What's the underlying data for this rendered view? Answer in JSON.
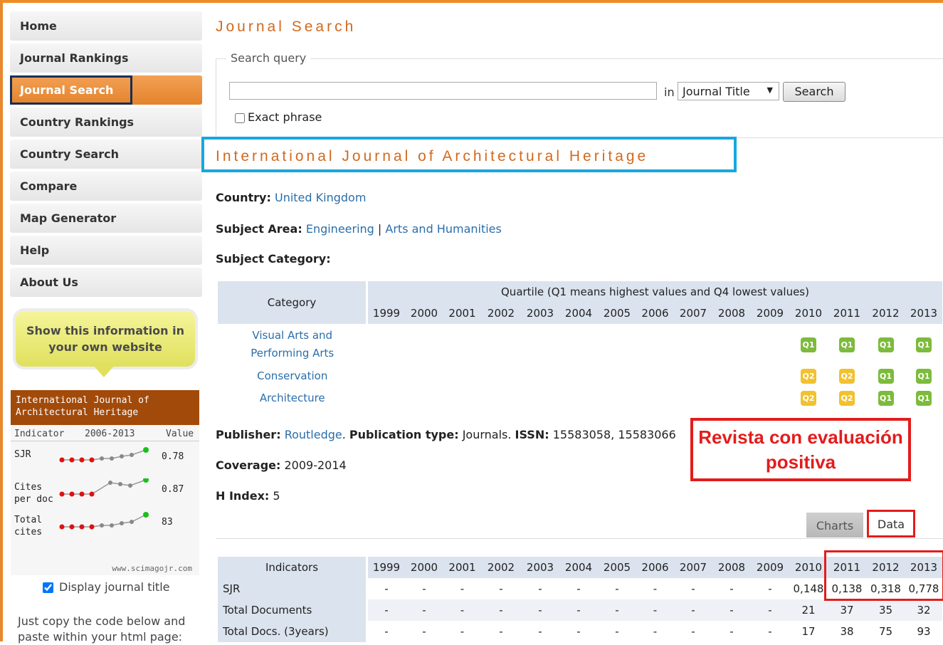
{
  "sidebar": {
    "items": [
      {
        "label": "Home"
      },
      {
        "label": "Journal Rankings"
      },
      {
        "label": "Journal Search"
      },
      {
        "label": "Country Rankings"
      },
      {
        "label": "Country Search"
      },
      {
        "label": "Compare"
      },
      {
        "label": "Map Generator"
      },
      {
        "label": "Help"
      },
      {
        "label": "About Us"
      }
    ],
    "bubble_text": "Show this information in your own website",
    "widget": {
      "title": "International Journal of Architectural Heritage",
      "col_indicator": "Indicator",
      "col_range": "2006-2013",
      "col_value": "Value",
      "rows": [
        {
          "label": "SJR",
          "value": "0.78"
        },
        {
          "label": "Cites per doc",
          "value": "0.87"
        },
        {
          "label": "Total cites",
          "value": "83"
        }
      ],
      "footer": "www.scimagojr.com"
    },
    "display_title_label": "Display journal title",
    "copy_text": "Just copy the code below and paste within your html page:"
  },
  "main": {
    "page_title": "Journal Search",
    "search": {
      "legend": "Search query",
      "value": "",
      "in_label": "in",
      "scope": "Journal Title",
      "button": "Search",
      "exact_label": "Exact phrase"
    },
    "journal_title": "International Journal of Architectural Heritage",
    "country_label": "Country:",
    "country": "United Kingdom",
    "subject_area_label": "Subject Area:",
    "subject_areas": [
      "Engineering",
      "Arts and Humanities"
    ],
    "subject_sep": "|",
    "subject_category_label": "Subject Category:",
    "quartile_table": {
      "category_header": "Category",
      "quartile_header": "Quartile (Q1 means highest values and Q4 lowest values)",
      "years": [
        "1999",
        "2000",
        "2001",
        "2002",
        "2003",
        "2004",
        "2005",
        "2006",
        "2007",
        "2008",
        "2009",
        "2010",
        "2011",
        "2012",
        "2013"
      ],
      "rows": [
        {
          "category": "Visual Arts and Performing Arts",
          "quartiles": [
            "",
            "",
            "",
            "",
            "",
            "",
            "",
            "",
            "",
            "",
            "",
            "Q1",
            "Q1",
            "Q1",
            "Q1"
          ]
        },
        {
          "category": "Conservation",
          "quartiles": [
            "",
            "",
            "",
            "",
            "",
            "",
            "",
            "",
            "",
            "",
            "",
            "Q2",
            "Q2",
            "Q1",
            "Q1"
          ]
        },
        {
          "category": "Architecture",
          "quartiles": [
            "",
            "",
            "",
            "",
            "",
            "",
            "",
            "",
            "",
            "",
            "",
            "Q2",
            "Q2",
            "Q1",
            "Q1"
          ]
        }
      ]
    },
    "publisher_label": "Publisher:",
    "publisher": "Routledge",
    "pubtype_label": "Publication type:",
    "pubtype": "Journals.",
    "issn_label": "ISSN:",
    "issn": "15583058, 15583066",
    "coverage_label": "Coverage:",
    "coverage": "2009-2014",
    "hindex_label": "H Index:",
    "hindex": "5",
    "annotation": "Revista con evaluación positiva",
    "tabs": {
      "charts": "Charts",
      "data": "Data"
    },
    "indicators_table": {
      "header": "Indicators",
      "years": [
        "1999",
        "2000",
        "2001",
        "2002",
        "2003",
        "2004",
        "2005",
        "2006",
        "2007",
        "2008",
        "2009",
        "2010",
        "2011",
        "2012",
        "2013"
      ],
      "rows": [
        {
          "label": "SJR",
          "values": [
            "-",
            "-",
            "-",
            "-",
            "-",
            "-",
            "-",
            "-",
            "-",
            "-",
            "-",
            "0,148",
            "0,138",
            "0,318",
            "0,778"
          ]
        },
        {
          "label": "Total Documents",
          "values": [
            "-",
            "-",
            "-",
            "-",
            "-",
            "-",
            "-",
            "-",
            "-",
            "-",
            "-",
            "21",
            "37",
            "35",
            "32"
          ]
        },
        {
          "label": "Total Docs. (3years)",
          "values": [
            "-",
            "-",
            "-",
            "-",
            "-",
            "-",
            "-",
            "-",
            "-",
            "-",
            "-",
            "17",
            "38",
            "75",
            "93"
          ]
        }
      ]
    }
  },
  "colors": {
    "accent": "#f08a24",
    "title": "#d2691e",
    "link": "#2a6eaa",
    "annotation": "#e31c1c",
    "highlight": "#17a7df",
    "q1": "#7dbb3b",
    "q2": "#f2c12e"
  }
}
